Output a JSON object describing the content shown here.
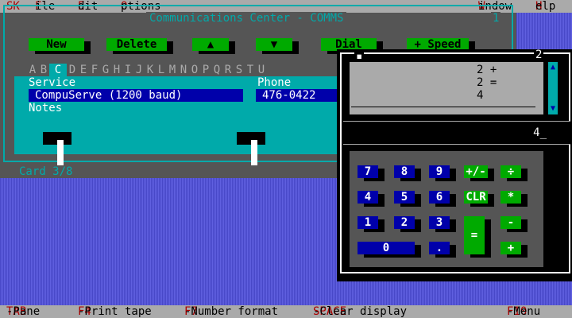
{
  "menu": {
    "app": {
      "hot": "SK",
      "rest": ""
    },
    "file": {
      "hot": "F",
      "rest": "ile"
    },
    "edit": {
      "hot": "E",
      "rest": "dit"
    },
    "options": {
      "hot": "O",
      "rest": "ptions"
    },
    "window": {
      "hot": "W",
      "rest": "indow"
    },
    "help": {
      "hot": "H",
      "rest": "elp"
    }
  },
  "comms": {
    "title": "Communications Center - COMMS",
    "window_number": "1",
    "buttons": {
      "new": "New",
      "delete": "Delete",
      "up": "▲",
      "down": "▼",
      "dial": "Dial",
      "speed": "+ Speed"
    },
    "letters": [
      "A",
      "B",
      "C",
      "D",
      "E",
      "F",
      "G",
      "H",
      "I",
      "J",
      "K",
      "L",
      "M",
      "N",
      "O",
      "P",
      "Q",
      "R",
      "S",
      "T",
      "U"
    ],
    "selected_letter": "C",
    "service_label": "Service",
    "service_value": "CompuServe (1200 baud)",
    "phone_label": "Phone",
    "phone_value": "476-0422",
    "notes_label": "Notes",
    "notes_value": "",
    "card_indicator": "Card 3/8"
  },
  "calculator": {
    "close_glyph": "▪",
    "window_number": "2",
    "tape": [
      "2 +",
      "2 =",
      "4"
    ],
    "display": "4_",
    "keys": {
      "k7": "7",
      "k8": "8",
      "k9": "9",
      "k4": "4",
      "k5": "5",
      "k6": "6",
      "k1": "1",
      "k2": "2",
      "k3": "3",
      "k0": "0",
      "dot": ".",
      "plusminus": "+/-",
      "divide": "÷",
      "clr": "CLR",
      "multiply": "*",
      "minus": "-",
      "plus": "+",
      "equals": "="
    }
  },
  "statusbar": {
    "tab_key": "TAB",
    "tab_text": "-Pane",
    "f4_key": "F4",
    "f4_text": "-Print tape",
    "f7_key": "F7",
    "f7_text": "-Number format",
    "space_key": "SPACE",
    "space_text": "-Clear display",
    "f10_key": "F10",
    "f10_text": "-Menu"
  }
}
